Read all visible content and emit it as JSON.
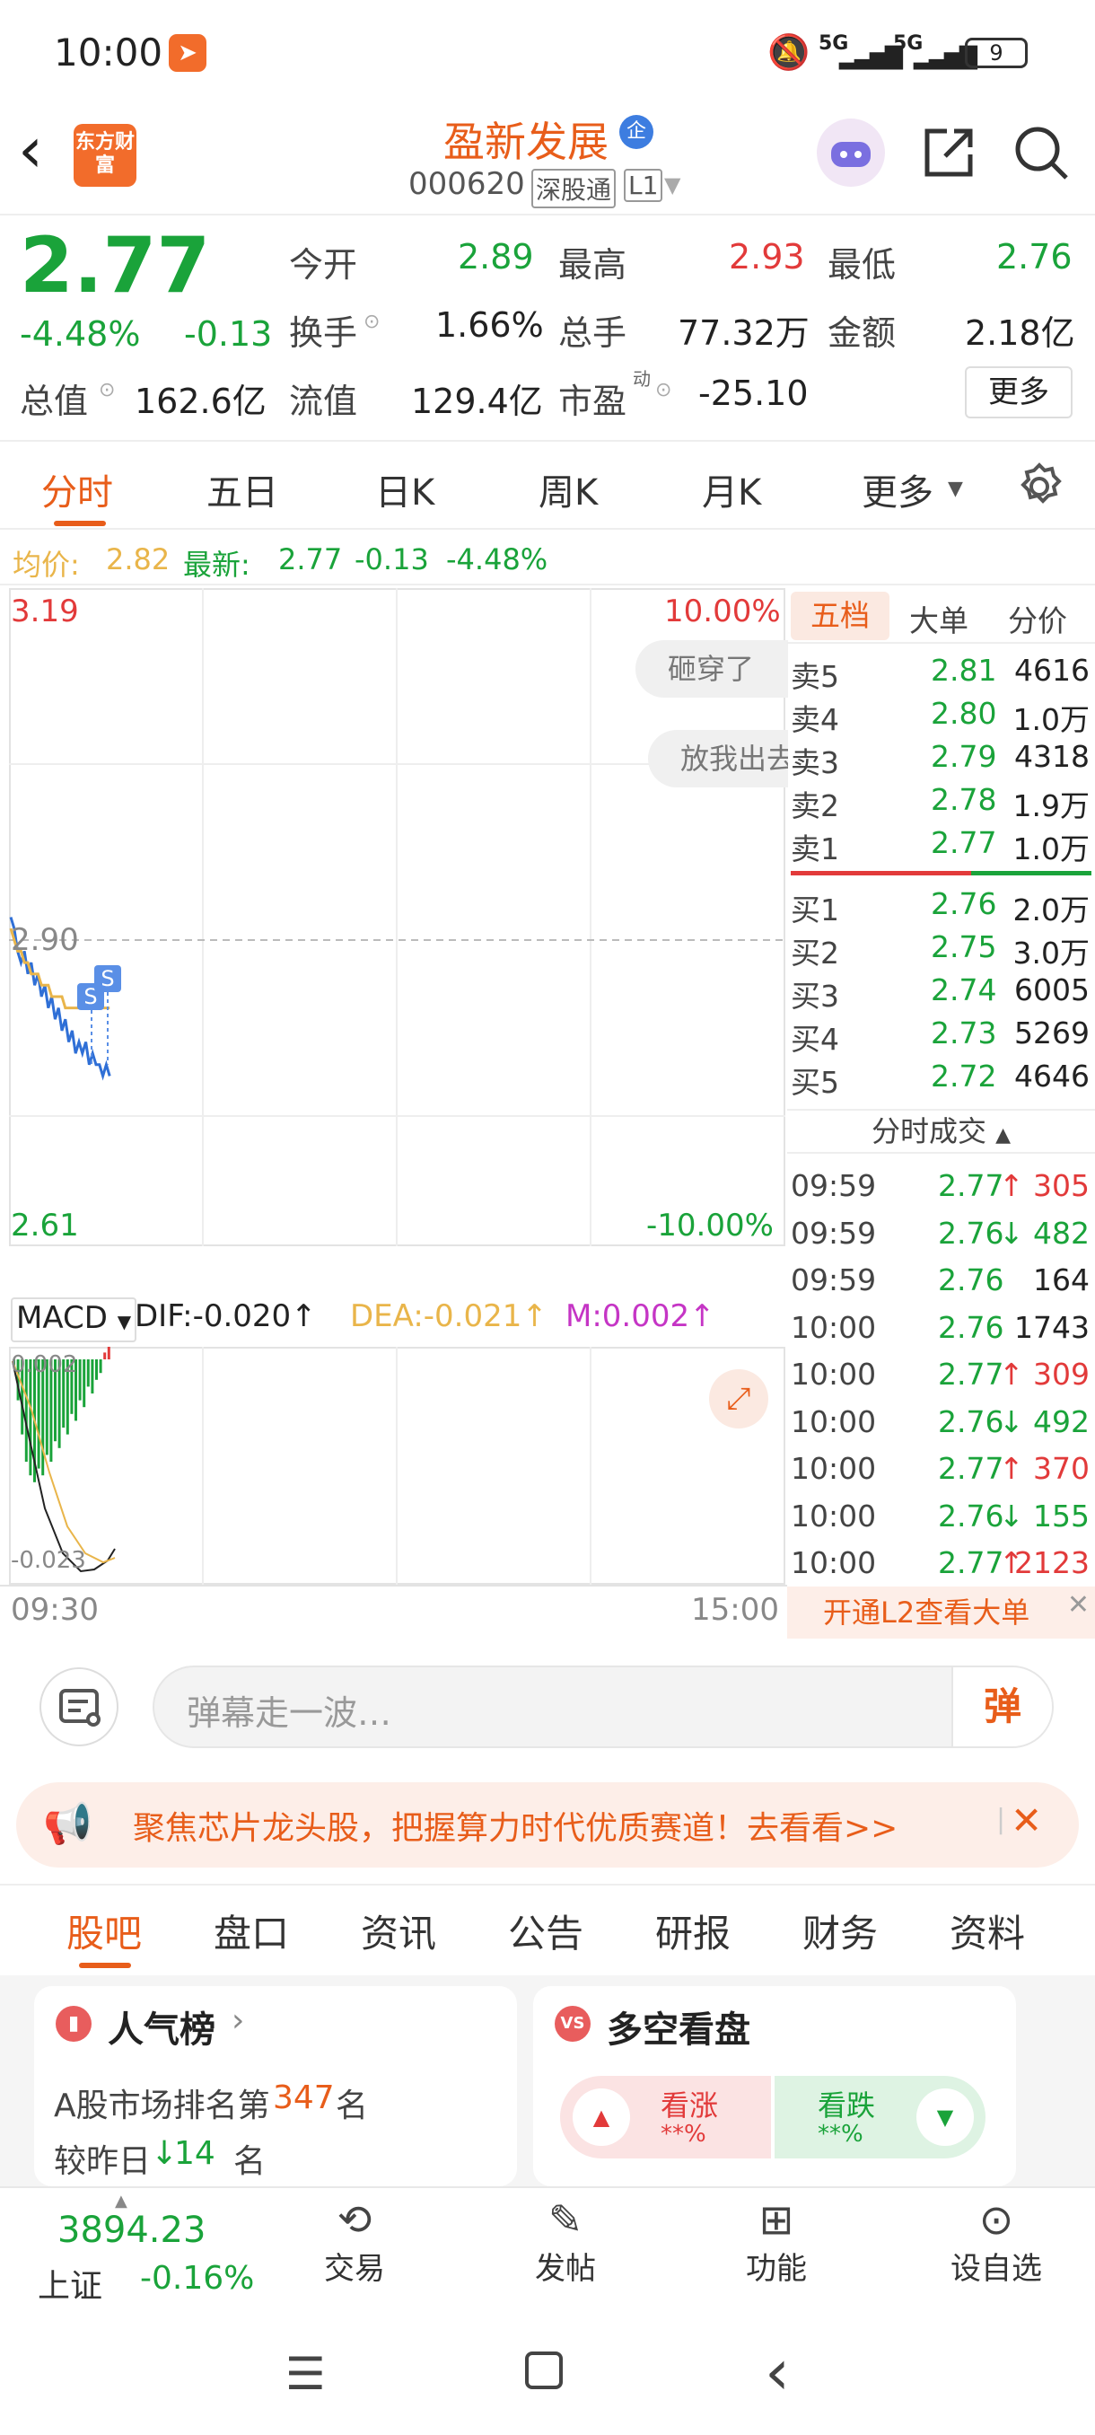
{
  "status": {
    "time": "10:00",
    "net1": "5G",
    "net2": "5G",
    "battery": "9"
  },
  "header": {
    "logo": "东方财富",
    "title": "盈新发展",
    "enterprise_badge": "企",
    "code": "000620",
    "tag1": "深股通",
    "tag2": "L1"
  },
  "quote": {
    "price": "2.77",
    "pct": "-4.48%",
    "chg": "-0.13",
    "open_label": "今开",
    "open": "2.89",
    "high_label": "最高",
    "high": "2.93",
    "low_label": "最低",
    "low": "2.76",
    "turnover_label": "换手",
    "turnover": "1.66%",
    "volume_label": "总手",
    "volume": "77.32万",
    "amount_label": "金额",
    "amount": "2.18亿",
    "mcap_label": "总值",
    "mcap": "162.6亿",
    "float_label": "流值",
    "float": "129.4亿",
    "pe_label": "市盈",
    "pe_sup": "动",
    "pe": "-25.10",
    "more": "更多"
  },
  "tabs": [
    "分时",
    "五日",
    "日K",
    "周K",
    "月K",
    "更多"
  ],
  "avg": {
    "avg_label": "均价:",
    "avg": "2.82",
    "latest_label": "最新:",
    "latest": "2.77",
    "chg": "-0.13",
    "pct": "-4.48%"
  },
  "chart": {
    "top": "3.19",
    "top_pct": "10.00%",
    "mid": "2.90",
    "bottom": "2.61",
    "bottom_pct": "-10.00%",
    "bubble1": "砸穿了",
    "bubble2": "放我出去",
    "start_time": "09:30",
    "end_time": "15:00",
    "marker": "S",
    "macd_label": "MACD",
    "dif": "DIF:-0.020↑",
    "dea": "DEA:-0.021↑",
    "m": "M:0.002↑",
    "macd_top": "0.002",
    "macd_bottom": "-0.023",
    "red": "#e23a3a",
    "green": "#1aa33a",
    "blue": "#2f6fd6",
    "yellow": "#e9b54a"
  },
  "chart_data": {
    "type": "line",
    "series": [
      {
        "name": "最新",
        "values": [
          2.9,
          2.89,
          2.87,
          2.86,
          2.87,
          2.85,
          2.86,
          2.84,
          2.85,
          2.83,
          2.84,
          2.82,
          2.83,
          2.81,
          2.82,
          2.8,
          2.81,
          2.79,
          2.8,
          2.78,
          2.79,
          2.78,
          2.79,
          2.77,
          2.78,
          2.77,
          2.77,
          2.76,
          2.77,
          2.76
        ]
      },
      {
        "name": "均价",
        "values": [
          2.89,
          2.88,
          2.87,
          2.87,
          2.86,
          2.86,
          2.85,
          2.85,
          2.85,
          2.84,
          2.84,
          2.84,
          2.83,
          2.83,
          2.83,
          2.83,
          2.82,
          2.82,
          2.82,
          2.82,
          2.82,
          2.82,
          2.82,
          2.82,
          2.82,
          2.82,
          2.82,
          2.82,
          2.82,
          2.82
        ]
      }
    ],
    "ylim": [
      2.61,
      3.19
    ],
    "x_range": [
      "09:30",
      "15:00"
    ],
    "macd": [
      -0.001,
      -0.006,
      -0.011,
      -0.015,
      -0.017,
      -0.018,
      -0.016,
      -0.017,
      -0.014,
      -0.015,
      -0.012,
      -0.013,
      -0.01,
      -0.011,
      -0.008,
      -0.009,
      -0.006,
      -0.007,
      -0.004,
      -0.005,
      -0.003,
      -0.002,
      0.001,
      0.002
    ]
  },
  "book": {
    "tabs": [
      "五档",
      "大单",
      "分价"
    ],
    "asks": [
      {
        "label": "卖5",
        "price": "2.81",
        "vol": "4616"
      },
      {
        "label": "卖4",
        "price": "2.80",
        "vol": "1.0万"
      },
      {
        "label": "卖3",
        "price": "2.79",
        "vol": "4318"
      },
      {
        "label": "卖2",
        "price": "2.78",
        "vol": "1.9万"
      },
      {
        "label": "卖1",
        "price": "2.77",
        "vol": "1.0万"
      }
    ],
    "bids": [
      {
        "label": "买1",
        "price": "2.76",
        "vol": "2.0万"
      },
      {
        "label": "买2",
        "price": "2.75",
        "vol": "3.0万"
      },
      {
        "label": "买3",
        "price": "2.74",
        "vol": "6005"
      },
      {
        "label": "买4",
        "price": "2.73",
        "vol": "5269"
      },
      {
        "label": "买5",
        "price": "2.72",
        "vol": "4646"
      }
    ],
    "trades_title": "分时成交",
    "trades": [
      {
        "t": "09:59",
        "p": "2.77",
        "d": "↑",
        "v": "305",
        "c": "red"
      },
      {
        "t": "09:59",
        "p": "2.76",
        "d": "↓",
        "v": "482",
        "c": "green"
      },
      {
        "t": "09:59",
        "p": "2.76",
        "d": "",
        "v": "164",
        "c": "black"
      },
      {
        "t": "10:00",
        "p": "2.76",
        "d": "",
        "v": "1743",
        "c": "black"
      },
      {
        "t": "10:00",
        "p": "2.77",
        "d": "↑",
        "v": "309",
        "c": "red"
      },
      {
        "t": "10:00",
        "p": "2.76",
        "d": "↓",
        "v": "492",
        "c": "green"
      },
      {
        "t": "10:00",
        "p": "2.77",
        "d": "↑",
        "v": "370",
        "c": "red"
      },
      {
        "t": "10:00",
        "p": "2.76",
        "d": "↓",
        "v": "155",
        "c": "green"
      },
      {
        "t": "10:00",
        "p": "2.77",
        "d": "↑",
        "v": "2123",
        "c": "red"
      }
    ],
    "l2_banner": "开通L2查看大单"
  },
  "danmu": {
    "placeholder": "弹幕走一波…",
    "button": "弹"
  },
  "ad": {
    "text": "聚焦芯片龙头股，把握算力时代优质赛道！去看看>>"
  },
  "tabs2": [
    "股吧",
    "盘口",
    "资讯",
    "公告",
    "研报",
    "财务",
    "资料"
  ],
  "cards": {
    "rank_title": "人气榜",
    "rank_line1_a": "A股市场排名第",
    "rank_num": "347",
    "rank_line1_b": "名",
    "rank_line2_a": "较昨日",
    "rank_change": "14",
    "rank_line2_b": "名",
    "vs_title": "多空看盘",
    "up_label": "看涨",
    "up_val": "**%",
    "down_label": "看跌",
    "down_val": "**%"
  },
  "bottom": {
    "index_val": "3894.23",
    "index_name": "上证",
    "index_pct": "-0.16%",
    "items": [
      "交易",
      "发帖",
      "功能",
      "设自选"
    ]
  }
}
